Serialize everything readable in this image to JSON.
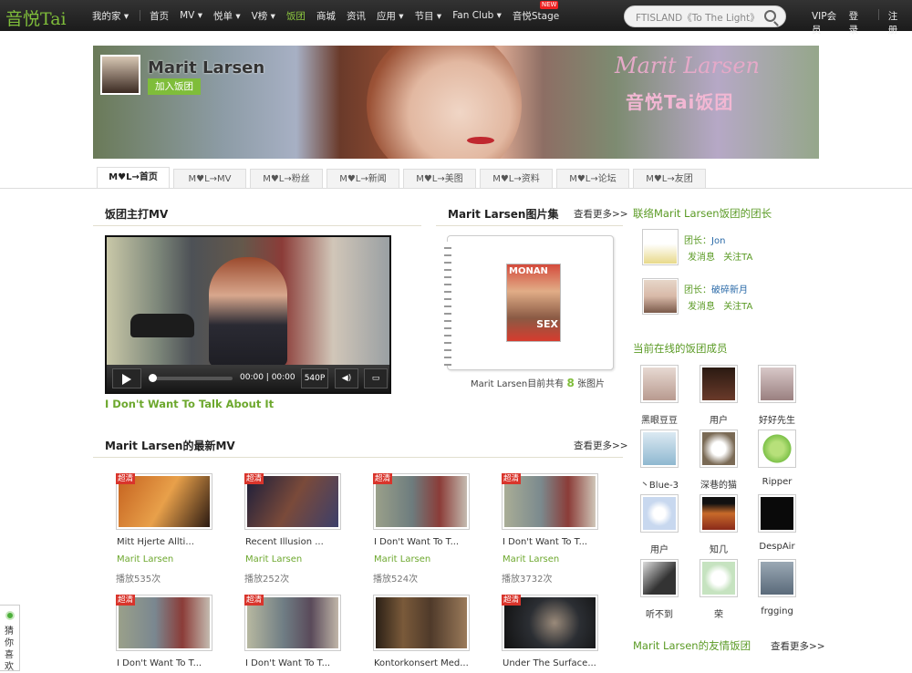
{
  "logo": "音悦Tai",
  "nav": [
    {
      "label": "我的家",
      "caret": "▾"
    },
    {
      "label": "首页",
      "caret": ""
    },
    {
      "label": "MV",
      "caret": "▾"
    },
    {
      "label": "悦单",
      "caret": "▾"
    },
    {
      "label": "V榜",
      "caret": "▾"
    },
    {
      "label": "饭团",
      "caret": ""
    },
    {
      "label": "商城",
      "caret": ""
    },
    {
      "label": "资讯",
      "caret": ""
    },
    {
      "label": "应用",
      "caret": "▾"
    },
    {
      "label": "节目",
      "caret": "▾"
    },
    {
      "label": "Fan Club",
      "caret": "▾"
    },
    {
      "label": "音悦Stage",
      "caret": "",
      "badge": "NEW"
    }
  ],
  "search": {
    "placeholder": "FTISLAND《To The Light》"
  },
  "header_links": {
    "vip": "VIP会员",
    "login": "登录",
    "register": "注册"
  },
  "banner": {
    "name": "Marit Larsen",
    "join_label": "加入饭团",
    "script_title": "Marit Larsen",
    "group_title": "音悦Tai饭团"
  },
  "tabs": [
    "M♥L→首页",
    "M♥L→MV",
    "M♥L→粉丝",
    "M♥L→新闻",
    "M♥L→美图",
    "M♥L→资料",
    "M♥L→论坛",
    "M♥L→友团"
  ],
  "featured": {
    "title": "饭团主打MV",
    "video_title": "I Don't Want To Talk About It",
    "time": "00:00 | 00:00",
    "quality": "540P"
  },
  "gallery": {
    "title": "Marit Larsen图片集",
    "more": "查看更多>>",
    "cover_title": "MONAN",
    "cover_text": "SEX",
    "caption_prefix": "Marit Larsen目前共有",
    "count": "8",
    "caption_suffix": "张图片"
  },
  "latest": {
    "title": "Marit Larsen的最新MV",
    "more": "查看更多>>",
    "items": [
      {
        "name": "Mitt Hjerte Allti...",
        "artist": "Marit Larsen",
        "plays": "播放535次",
        "badge": "超清",
        "color": "#c5621f"
      },
      {
        "name": "Recent Illusion ...",
        "artist": "Marit Larsen",
        "plays": "播放252次",
        "badge": "超清",
        "color": "#3c3f6a"
      },
      {
        "name": "I Don't Want To T...",
        "artist": "Marit Larsen",
        "plays": "播放524次",
        "badge": "超清",
        "color": "#6d7c7e"
      },
      {
        "name": "I Don't Want To T...",
        "artist": "Marit Larsen",
        "plays": "播放3732次",
        "badge": "超清",
        "color": "#7b8a8e"
      },
      {
        "name": "I Don't Want To T...",
        "artist": "",
        "plays": "",
        "badge": "超清",
        "color": "#7a8790"
      },
      {
        "name": "I Don't Want To T...",
        "artist": "",
        "plays": "",
        "badge": "超清",
        "color": "#6f7d84"
      },
      {
        "name": "Kontorkonsert Med...",
        "artist": "",
        "plays": "",
        "badge": "",
        "color": "#4f3a2a"
      },
      {
        "name": "Under The Surface...",
        "artist": "",
        "plays": "",
        "badge": "超清",
        "color": "#2b2e33"
      }
    ]
  },
  "sidebar": {
    "leaders_title": "联络Marit Larsen饭团的团长",
    "leaders": [
      {
        "label": "团长：",
        "name": "Jon",
        "msg": "发消息",
        "follow": "关注TA",
        "color": "#e8d98a"
      },
      {
        "label": "团长：",
        "name": "破碎新月",
        "msg": "发消息",
        "follow": "关注TA",
        "color": "#d8b9a8"
      }
    ],
    "online_title": "当前在线的饭团成员",
    "members": [
      {
        "name": "黑眼豆豆",
        "color": "#b89a8f"
      },
      {
        "name": "用户",
        "color": "#6a3a2a"
      },
      {
        "name": "好好先生",
        "color": "#9a8080"
      },
      {
        "name": "丶Blue-3",
        "color": "#8fb8d0"
      },
      {
        "name": "深巷的猫",
        "color": "#7a6a55"
      },
      {
        "name": "Ripper",
        "color": "#7ec24a"
      },
      {
        "name": "用户",
        "color": "#c8d8ef"
      },
      {
        "name": "知几",
        "color": "#8a2a1a"
      },
      {
        "name": "DespAir",
        "color": "#0a0a0a"
      },
      {
        "name": "听不到",
        "color": "#333"
      },
      {
        "name": "荣",
        "color": "#c6e3c0"
      },
      {
        "name": "frgging",
        "color": "#5a6a7a"
      }
    ],
    "friends_title": "Marit Larsen的友情饭团",
    "friends_more": "查看更多>>"
  },
  "guess": {
    "label": "猜你喜欢"
  }
}
